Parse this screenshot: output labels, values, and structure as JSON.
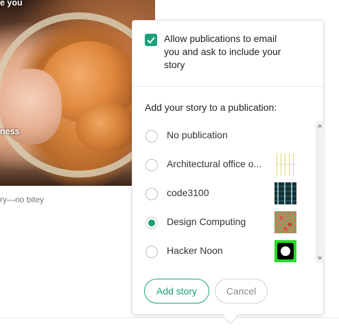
{
  "background": {
    "overlay_top": "e you",
    "overlay_mid": "ness",
    "caption": "ry—no bitey"
  },
  "popover": {
    "allow_label": "Allow publications to email you and ask to include your story",
    "allow_checked": true,
    "heading": "Add your story to a publication:",
    "publications": [
      {
        "name": "No publication",
        "selected": false,
        "thumb": ""
      },
      {
        "name": "Architectural office o...",
        "selected": false,
        "thumb": "architectural-thumb"
      },
      {
        "name": "code3100",
        "selected": false,
        "thumb": "code3100-thumb"
      },
      {
        "name": "Design Computing",
        "selected": true,
        "thumb": "design-computing-thumb"
      },
      {
        "name": "Hacker Noon",
        "selected": false,
        "thumb": "hacker-noon-thumb"
      }
    ],
    "add_button": "Add story",
    "cancel_button": "Cancel",
    "accent_color": "#1aa07a"
  }
}
